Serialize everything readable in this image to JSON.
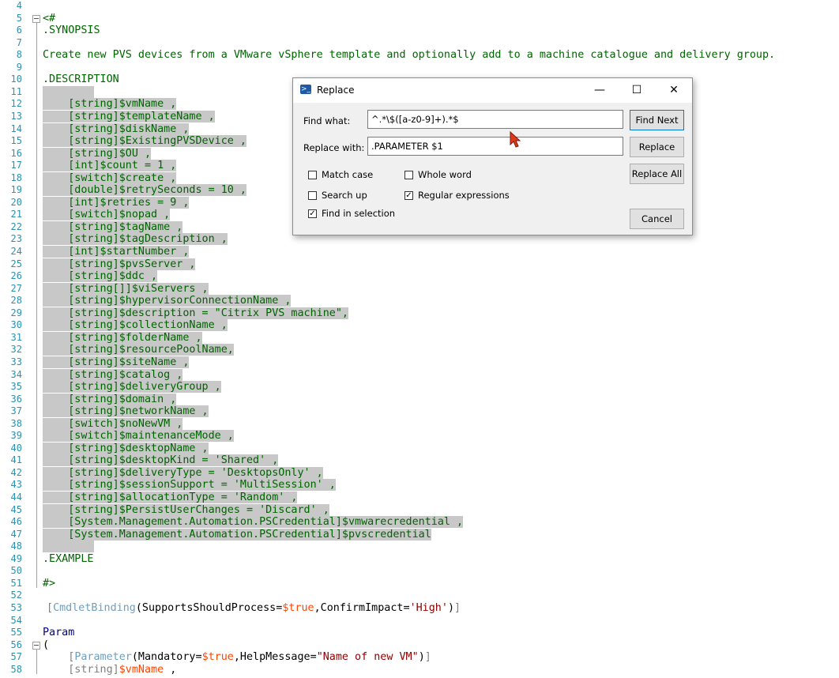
{
  "editor": {
    "lines": [
      {
        "n": "4",
        "t": ""
      },
      {
        "n": "5",
        "t": "<#"
      },
      {
        "n": "6",
        "t": ".SYNOPSIS"
      },
      {
        "n": "7",
        "t": ""
      },
      {
        "n": "8",
        "t": "Create new PVS devices from a VMware vSphere template and optionally add to a machine catalogue and delivery group."
      },
      {
        "n": "9",
        "t": ""
      },
      {
        "n": "10",
        "t": ".DESCRIPTION"
      },
      {
        "n": "11",
        "t": ""
      },
      {
        "n": "12",
        "t": "    [string]$vmName ,"
      },
      {
        "n": "13",
        "t": "    [string]$templateName ,"
      },
      {
        "n": "14",
        "t": "    [string]$diskName ,"
      },
      {
        "n": "15",
        "t": "    [string]$ExistingPVSDevice ,"
      },
      {
        "n": "16",
        "t": "    [string]$OU ,"
      },
      {
        "n": "17",
        "t": "    [int]$count = 1 ,"
      },
      {
        "n": "18",
        "t": "    [switch]$create ,"
      },
      {
        "n": "19",
        "t": "    [double]$retrySeconds = 10 ,"
      },
      {
        "n": "20",
        "t": "    [int]$retries = 9 ,"
      },
      {
        "n": "21",
        "t": "    [switch]$nopad ,"
      },
      {
        "n": "22",
        "t": "    [string]$tagName ,"
      },
      {
        "n": "23",
        "t": "    [string]$tagDescription ,"
      },
      {
        "n": "24",
        "t": "    [int]$startNumber ,"
      },
      {
        "n": "25",
        "t": "    [string]$pvsServer ,"
      },
      {
        "n": "26",
        "t": "    [string]$ddc ,"
      },
      {
        "n": "27",
        "t": "    [string[]]$viServers ,"
      },
      {
        "n": "28",
        "t": "    [string]$hypervisorConnectionName ,"
      },
      {
        "n": "29",
        "t": "    [string]$description = \"Citrix PVS machine\","
      },
      {
        "n": "30",
        "t": "    [string]$collectionName ,"
      },
      {
        "n": "31",
        "t": "    [string]$folderName ,"
      },
      {
        "n": "32",
        "t": "    [string]$resourcePoolName,"
      },
      {
        "n": "33",
        "t": "    [string]$siteName ,"
      },
      {
        "n": "34",
        "t": "    [string]$catalog ,"
      },
      {
        "n": "35",
        "t": "    [string]$deliveryGroup ,"
      },
      {
        "n": "36",
        "t": "    [string]$domain ,"
      },
      {
        "n": "37",
        "t": "    [string]$networkName ,"
      },
      {
        "n": "38",
        "t": "    [switch]$noNewVM ,"
      },
      {
        "n": "39",
        "t": "    [switch]$maintenanceMode ,"
      },
      {
        "n": "40",
        "t": "    [string]$desktopName ,"
      },
      {
        "n": "41",
        "t": "    [string]$desktopKind = 'Shared' ,"
      },
      {
        "n": "42",
        "t": "    [string]$deliveryType = 'DesktopsOnly' ,"
      },
      {
        "n": "43",
        "t": "    [string]$sessionSupport = 'MultiSession' ,"
      },
      {
        "n": "44",
        "t": "    [string]$allocationType = 'Random' ,"
      },
      {
        "n": "45",
        "t": "    [string]$PersistUserChanges = 'Discard' ,"
      },
      {
        "n": "46",
        "t": "    [System.Management.Automation.PSCredential]$vmwarecredential ,"
      },
      {
        "n": "47",
        "t": "    [System.Management.Automation.PSCredential]$pvscredential"
      },
      {
        "n": "48",
        "t": ""
      },
      {
        "n": "49",
        "t": ".EXAMPLE"
      },
      {
        "n": "50",
        "t": ""
      },
      {
        "n": "51",
        "t": "#>"
      },
      {
        "n": "52",
        "t": ""
      },
      {
        "n": "53",
        "t": ""
      },
      {
        "n": "54",
        "t": ""
      },
      {
        "n": "55",
        "t": "Param"
      },
      {
        "n": "56",
        "t": "("
      },
      {
        "n": "57",
        "t": ""
      },
      {
        "n": "58",
        "t": ""
      }
    ],
    "line53": {
      "open": "[",
      "attr": "CmdletBinding",
      "p1": "(SupportsShouldProcess=",
      "v1": "$true",
      "p2": ",ConfirmImpact=",
      "s1": "'High'",
      "p3": ")",
      "close": "]"
    },
    "line57": {
      "open": "    [",
      "attr": "Parameter",
      "p1": "(Mandatory=",
      "v1": "$true",
      "p2": ",HelpMessage=",
      "s1": "\"Name of new VM\"",
      "p3": ")",
      "close": "]"
    },
    "line58": {
      "pre": "    [string]",
      "v": "$vmName",
      "post": " ,"
    }
  },
  "dialog": {
    "title": "Replace",
    "find_label": "Find what:",
    "find_value": "^.*\\$([a-z0-9]+).*$",
    "replace_label": "Replace with:",
    "replace_value": ".PARAMETER $1",
    "btn_find_next": "Find Next",
    "btn_replace": "Replace",
    "btn_replace_all": "Replace All",
    "btn_cancel": "Cancel",
    "match_case": {
      "label": "Match case",
      "checked": false
    },
    "whole_word": {
      "label": "Whole word",
      "checked": false
    },
    "search_up": {
      "label": "Search up",
      "checked": false
    },
    "regex": {
      "label": "Regular expressions",
      "checked": true
    },
    "find_in_selection": {
      "label": "Find in selection",
      "checked": true
    },
    "minimize_glyph": "—",
    "maximize_glyph": "☐",
    "close_glyph": "✕",
    "check_glyph": "✓"
  }
}
